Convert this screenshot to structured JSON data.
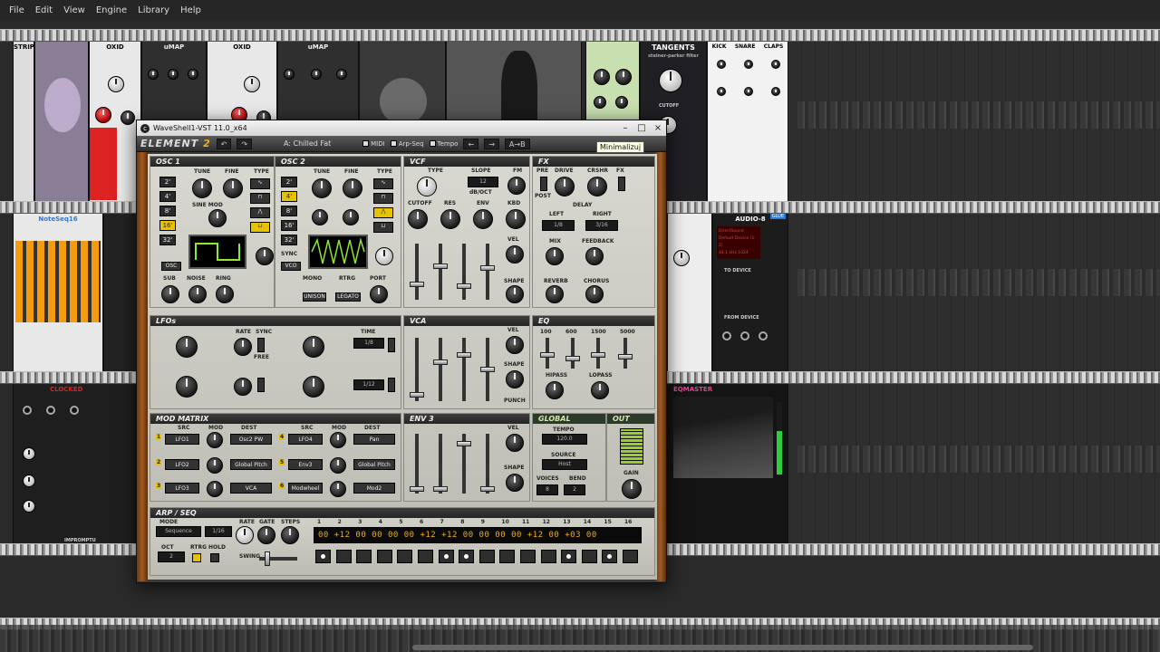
{
  "menubar": {
    "items": [
      {
        "label": "File"
      },
      {
        "label": "Edit"
      },
      {
        "label": "View"
      },
      {
        "label": "Engine"
      },
      {
        "label": "Library"
      },
      {
        "label": "Help"
      }
    ]
  },
  "rack_modules": {
    "row1": [
      "STRIP",
      "OXID",
      "uMAP",
      "OXID",
      "uMAP",
      "Tangents"
    ],
    "tangents": {
      "title": "TANGENTS",
      "subtitle": "steiner-parker filter",
      "cutoff": "CUTOFF"
    },
    "drums": {
      "kick": "KICK",
      "snare": "SNARE",
      "claps": "CLAPS"
    },
    "notes": {
      "title": "NoteSeq16"
    },
    "audio": {
      "title": "AUDIO-8",
      "glue": "GLUE",
      "device": "DirectSound",
      "driver": "Default Device (1-2)",
      "rate": "44.1 kHz 1024",
      "to_device": "TO DEVICE",
      "from_device": "FROM DEVICE"
    },
    "clocked": {
      "title": "CLOCKED",
      "footer": "IMPROMPTU"
    },
    "eq": {
      "title": "EQMASTER"
    }
  },
  "window": {
    "title": "WaveShell1-VST 11.0_x64",
    "minimize": "–",
    "maximize": "□",
    "close": "×",
    "tooltip": "Minimalizuj"
  },
  "toolbar": {
    "logo_main": "ELEMENT",
    "logo_num": "2",
    "preset": "A: Chilled Fat",
    "midi": "MIDI",
    "arpseq": "Arp-Seq",
    "tempo": "Tempo",
    "ab": "A→B"
  },
  "osc1": {
    "title": "OSC 1",
    "tune": "TUNE",
    "fine": "FINE",
    "type": "TYPE",
    "sine_mod": "SINE MOD",
    "octaves": [
      "2'",
      "4'",
      "8'",
      "16'",
      "32'"
    ],
    "active_octave": "16'",
    "sub": "SUB",
    "noise": "NOISE",
    "ring": "RING",
    "osc1": "OSC1",
    "osc2": "OSC2",
    "mono": "MONO",
    "rtrg": "RTRG",
    "port": "PORT",
    "unison": "UNISON",
    "legato": "LEGATO",
    "mix": "MIX",
    "osc_btn": "OSC"
  },
  "osc2": {
    "title": "OSC 2",
    "tune": "TUNE",
    "fine": "FINE",
    "type": "TYPE",
    "octaves": [
      "2'",
      "4'",
      "8'",
      "16'",
      "32'"
    ],
    "active_octave": "4'",
    "sync": "SYNC",
    "vco": "VCO"
  },
  "vcf": {
    "title": "VCF",
    "type": "TYPE",
    "slope": "SLOPE",
    "slope_value": "12",
    "db_oct": "dB/OCT",
    "fm": "FM",
    "cutoff": "CUTOFF",
    "res": "RES",
    "env": "ENV",
    "kbd": "KBD",
    "vel": "VEL",
    "shape": "SHAPE",
    "adsr": [
      "A",
      "D",
      "S",
      "R"
    ]
  },
  "fx": {
    "title": "FX",
    "pre": "PRE",
    "drive": "DRIVE",
    "post": "POST",
    "crshr": "CRSHR",
    "fx": "FX",
    "delay": "DELAY",
    "left": "LEFT",
    "right": "RIGHT",
    "left_value": "1/8",
    "right_value": "3/16",
    "mix": "MIX",
    "feedback": "FEEDBACK",
    "reverb": "REVERB",
    "chorus": "CHORUS"
  },
  "lfos": {
    "title": "LFOs",
    "rate": "RATE",
    "sync": "SYNC",
    "free": "FREE",
    "time": "TIME",
    "lfo3_value": "1/8",
    "lfo4_value": "1/12"
  },
  "vca": {
    "title": "VCA",
    "vel": "VEL",
    "shape": "SHAPE",
    "punch": "PUNCH",
    "adsr": [
      "A",
      "D",
      "S",
      "R"
    ]
  },
  "eq": {
    "title": "EQ",
    "bands": [
      "100",
      "600",
      "1500",
      "5000"
    ],
    "hipass": "HIPASS",
    "lopass": "LOPASS"
  },
  "mod_matrix": {
    "title": "MOD MATRIX",
    "src": "SRC",
    "mod": "MOD",
    "dest": "DEST",
    "rows": [
      {
        "num": "1",
        "src": "LFO1",
        "dest": "Osc2 PW"
      },
      {
        "num": "2",
        "src": "LFO2",
        "dest": "Global Pitch"
      },
      {
        "num": "3",
        "src": "LFO3",
        "dest": "VCA"
      },
      {
        "num": "4",
        "src": "LFO4",
        "dest": "Pan"
      },
      {
        "num": "5",
        "src": "Env3",
        "dest": "Global Pitch"
      },
      {
        "num": "6",
        "src": "Modwheel",
        "dest": "Mod2"
      }
    ]
  },
  "env3": {
    "title": "ENV 3",
    "vel": "VEL",
    "shape": "SHAPE",
    "adsr": [
      "A",
      "D",
      "S",
      "R"
    ]
  },
  "global": {
    "title": "GLOBAL",
    "tempo": "TEMPO",
    "tempo_value": "120.0",
    "source": "SOURCE",
    "source_value": "Host",
    "voices": "VOICES",
    "bend": "BEND",
    "voices_value": "8",
    "bend_value": "2"
  },
  "out": {
    "title": "OUT",
    "gain": "GAIN"
  },
  "arp": {
    "title": "ARP / SEQ",
    "mode": "MODE",
    "mode_value": "Sequence",
    "rate": "RATE",
    "rate_value": "1/16",
    "gate": "GATE",
    "steps": "STEPS",
    "oct": "OCT",
    "oct_value": "2",
    "rtrg": "RTRG",
    "hold": "HOLD",
    "swing": "SWING",
    "step_numbers": [
      "1",
      "2",
      "3",
      "4",
      "5",
      "6",
      "7",
      "8",
      "9",
      "10",
      "11",
      "12",
      "13",
      "14",
      "15",
      "16"
    ],
    "display": "00 +12 00 00 00 00 +12 +12 00 00 00 00 +12 00 +03 00",
    "steps_on": [
      1,
      0,
      0,
      0,
      0,
      0,
      1,
      1,
      0,
      0,
      0,
      0,
      1,
      0,
      1,
      0
    ]
  }
}
